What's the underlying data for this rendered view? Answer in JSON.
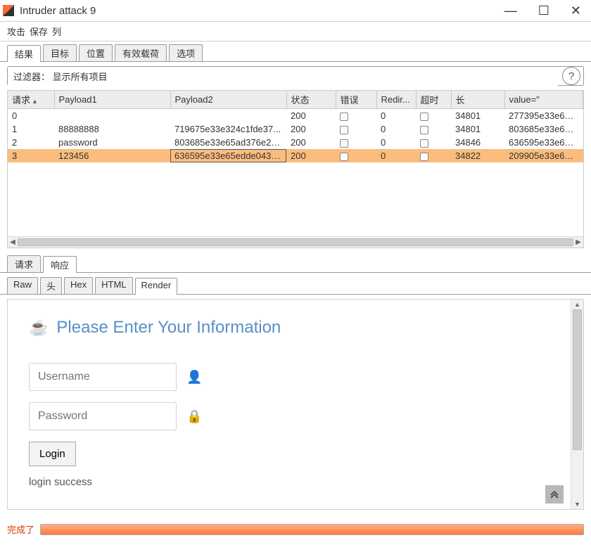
{
  "window": {
    "title": "Intruder attack 9"
  },
  "menu": {
    "items": [
      "攻击",
      "保存",
      "列"
    ]
  },
  "mainTabs": {
    "items": [
      "结果",
      "目标",
      "位置",
      "有效载荷",
      "选项"
    ],
    "active": 0
  },
  "filter": {
    "text": "过滤器： 显示所有项目",
    "helpGlyph": "?"
  },
  "table": {
    "headers": [
      "请求",
      "Payload1",
      "Payload2",
      "状态",
      "错误",
      "Redir...",
      "超时",
      "长",
      "value=\""
    ],
    "rows": [
      {
        "req": "0",
        "p1": "",
        "p2": "",
        "status": "200",
        "redir": "0",
        "len": "34801",
        "val": "277395e33e656c94..."
      },
      {
        "req": "1",
        "p1": "88888888",
        "p2": "719675e33e324c1fde37...",
        "status": "200",
        "redir": "0",
        "len": "34801",
        "val": "803685e33e65ad37..."
      },
      {
        "req": "2",
        "p1": "password",
        "p2": "803685e33e65ad376e23...",
        "status": "200",
        "redir": "0",
        "len": "34846",
        "val": "636595e33e65edde..."
      },
      {
        "req": "3",
        "p1": "123456",
        "p2": "636595e33e65edde0437...",
        "status": "200",
        "redir": "0",
        "len": "34822",
        "val": "209905e33e662e97..."
      }
    ],
    "selectedIndex": 3
  },
  "rrTabs": {
    "items": [
      "请求",
      "响应"
    ],
    "active": 1
  },
  "viewTabs": {
    "items": [
      "Raw",
      "头",
      "Hex",
      "HTML",
      "Render"
    ],
    "active": 4
  },
  "render": {
    "heading": "Please Enter Your Information",
    "usernamePlaceholder": "Username",
    "passwordPlaceholder": "Password",
    "loginLabel": "Login",
    "message": "login success"
  },
  "status": {
    "text": "完成了"
  }
}
